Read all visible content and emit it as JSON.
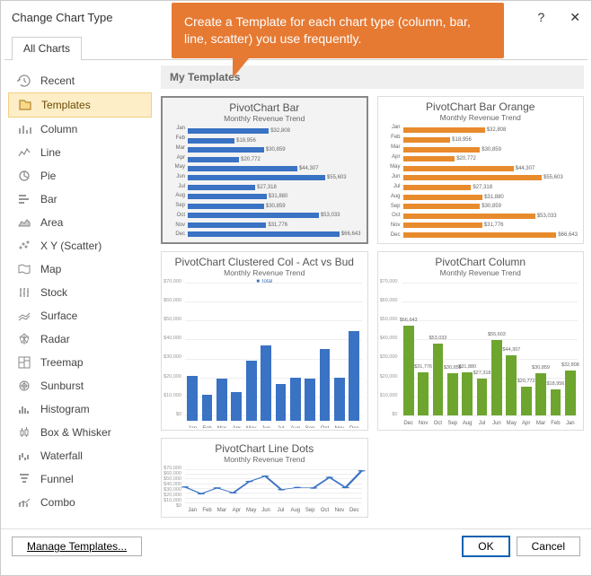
{
  "window": {
    "title": "Change Chart Type"
  },
  "callout": {
    "text": "Create a Template for each chart type (column, bar, line, scatter) you use frequently."
  },
  "tab": {
    "label": "All Charts"
  },
  "sidebar": {
    "items": [
      {
        "label": "Recent"
      },
      {
        "label": "Templates",
        "selected": true
      },
      {
        "label": "Column"
      },
      {
        "label": "Line"
      },
      {
        "label": "Pie"
      },
      {
        "label": "Bar"
      },
      {
        "label": "Area"
      },
      {
        "label": "X Y (Scatter)"
      },
      {
        "label": "Map"
      },
      {
        "label": "Stock"
      },
      {
        "label": "Surface"
      },
      {
        "label": "Radar"
      },
      {
        "label": "Treemap"
      },
      {
        "label": "Sunburst"
      },
      {
        "label": "Histogram"
      },
      {
        "label": "Box & Whisker"
      },
      {
        "label": "Waterfall"
      },
      {
        "label": "Funnel"
      },
      {
        "label": "Combo"
      }
    ]
  },
  "panel": {
    "title": "My Templates",
    "templates": [
      {
        "name": "PivotChart Bar",
        "subtitle": "Monthly Revenue Trend",
        "selected": true,
        "kind": "hbar",
        "color": "#3a72c4"
      },
      {
        "name": "PivotChart Bar Orange",
        "subtitle": "Monthly Revenue Trend",
        "kind": "hbar",
        "color": "#e88b2d"
      },
      {
        "name": "PivotChart Clustered Col - Act vs Bud",
        "subtitle": "Monthly Revenue Trend",
        "legend": "Total",
        "kind": "vbar",
        "color": "#3a72c4"
      },
      {
        "name": "PivotChart Column",
        "subtitle": "Monthly Revenue Trend",
        "kind": "vbar_rev",
        "color": "#6ea52f"
      },
      {
        "name": "PivotChart Line Dots",
        "subtitle": "Monthly Revenue Trend",
        "kind": "line",
        "color": "#3a72c4"
      }
    ]
  },
  "buttons": {
    "manage": "Manage Templates...",
    "ok": "OK",
    "cancel": "Cancel"
  },
  "chart_data": {
    "months": [
      "Jan",
      "Feb",
      "Mar",
      "Apr",
      "May",
      "Jun",
      "Jul",
      "Aug",
      "Sep",
      "Oct",
      "Nov",
      "Dec"
    ],
    "months_rev": [
      "Dec",
      "Nov",
      "Oct",
      "Sep",
      "Aug",
      "Jul",
      "Jun",
      "May",
      "Apr",
      "Mar",
      "Feb",
      "Jan"
    ],
    "values": [
      32808,
      18956,
      30859,
      20772,
      44307,
      55603,
      27318,
      31880,
      30859,
      53033,
      31776,
      66643
    ],
    "values_rev": [
      66643,
      31776,
      53033,
      30859,
      31880,
      27318,
      55603,
      44307,
      20772,
      30859,
      18956,
      32808
    ],
    "value_labels": [
      "$32,808",
      "$18,956",
      "$30,859",
      "$20,772",
      "$44,307",
      "$55,603",
      "$27,318",
      "$31,880",
      "$30,859",
      "$53,033",
      "$31,776",
      "$66,643"
    ],
    "value_labels_rev": [
      "$66,643",
      "$31,776",
      "$53,033",
      "$30,859",
      "$31,880",
      "$27,318",
      "$55,603",
      "$44,307",
      "$20,772",
      "$30,859",
      "$18,956",
      "$32,808"
    ],
    "y_axis_cluster": [
      "$70,000",
      "$60,000",
      "$50,000",
      "$40,000",
      "$30,000",
      "$20,000",
      "$10,000",
      "$0"
    ],
    "max": 70000
  }
}
